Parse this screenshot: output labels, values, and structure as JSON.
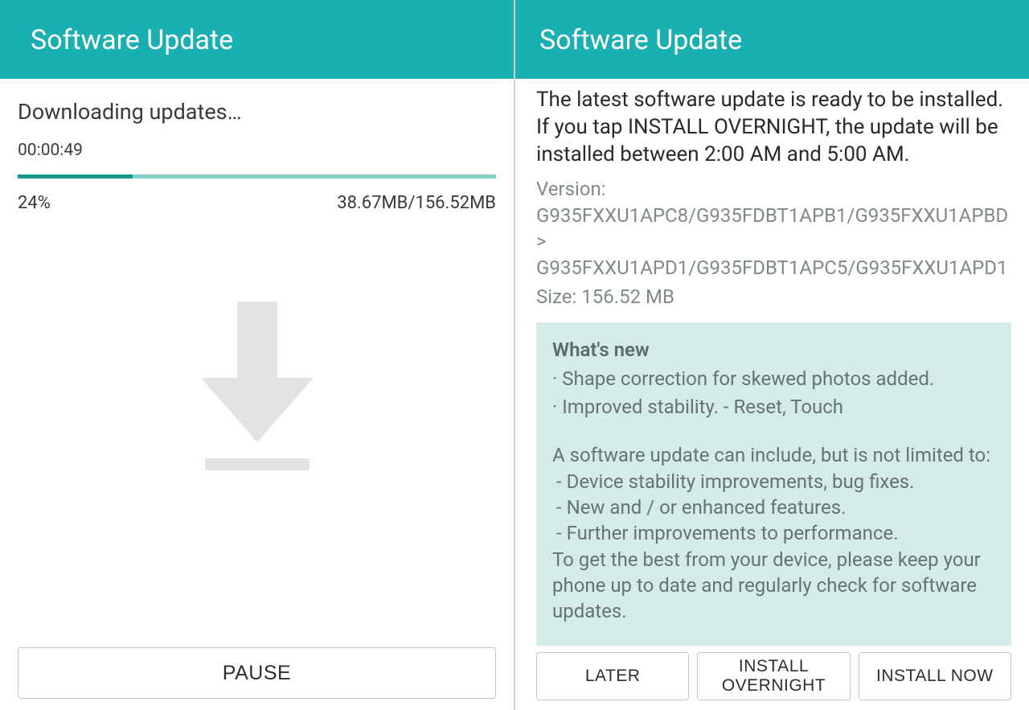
{
  "left": {
    "header_title": "Software Update",
    "status": "Downloading updates…",
    "elapsed": "00:00:49",
    "percent": "24%",
    "progress_value": 24,
    "size_current": "38.67MB",
    "size_total": "156.52MB",
    "pause_label": "PAUSE"
  },
  "right": {
    "header_title": "Software Update",
    "ready_text": "The latest software update is ready to be installed. If you tap INSTALL OVERNIGHT, the update will be installed between 2:00 AM and 5:00 AM.",
    "version_label": "Version:",
    "version_text": "G935FXXU1APC8/G935FDBT1APB1/G935FXXU1APBD > G935FXXU1APD1/G935FDBT1APC5/G935FXXU1APD1",
    "size_label": "Size:",
    "size_value": "156.52 MB",
    "whats_new_title": "What's new",
    "whats_new": {
      "item1": "· Shape correction for skewed photos added.",
      "item2": "· Improved stability. - Reset, Touch",
      "body_intro": "A software update can include, but is not limited to:",
      "sub1": " - Device stability improvements, bug fixes.",
      "sub2": " - New and / or enhanced features.",
      "sub3": " - Further improvements to performance.",
      "footer": "To get the best from your device, please keep your phone up to date and regularly check for software updates."
    },
    "buttons": {
      "later": "LATER",
      "overnight": "INSTALL OVERNIGHT",
      "now": "INSTALL NOW"
    }
  },
  "colors": {
    "header_bg": "#1aafb0",
    "progress_track": "#82cfc4",
    "progress_fill": "#0d9a8a",
    "whats_new_bg": "#d5ebe9"
  }
}
